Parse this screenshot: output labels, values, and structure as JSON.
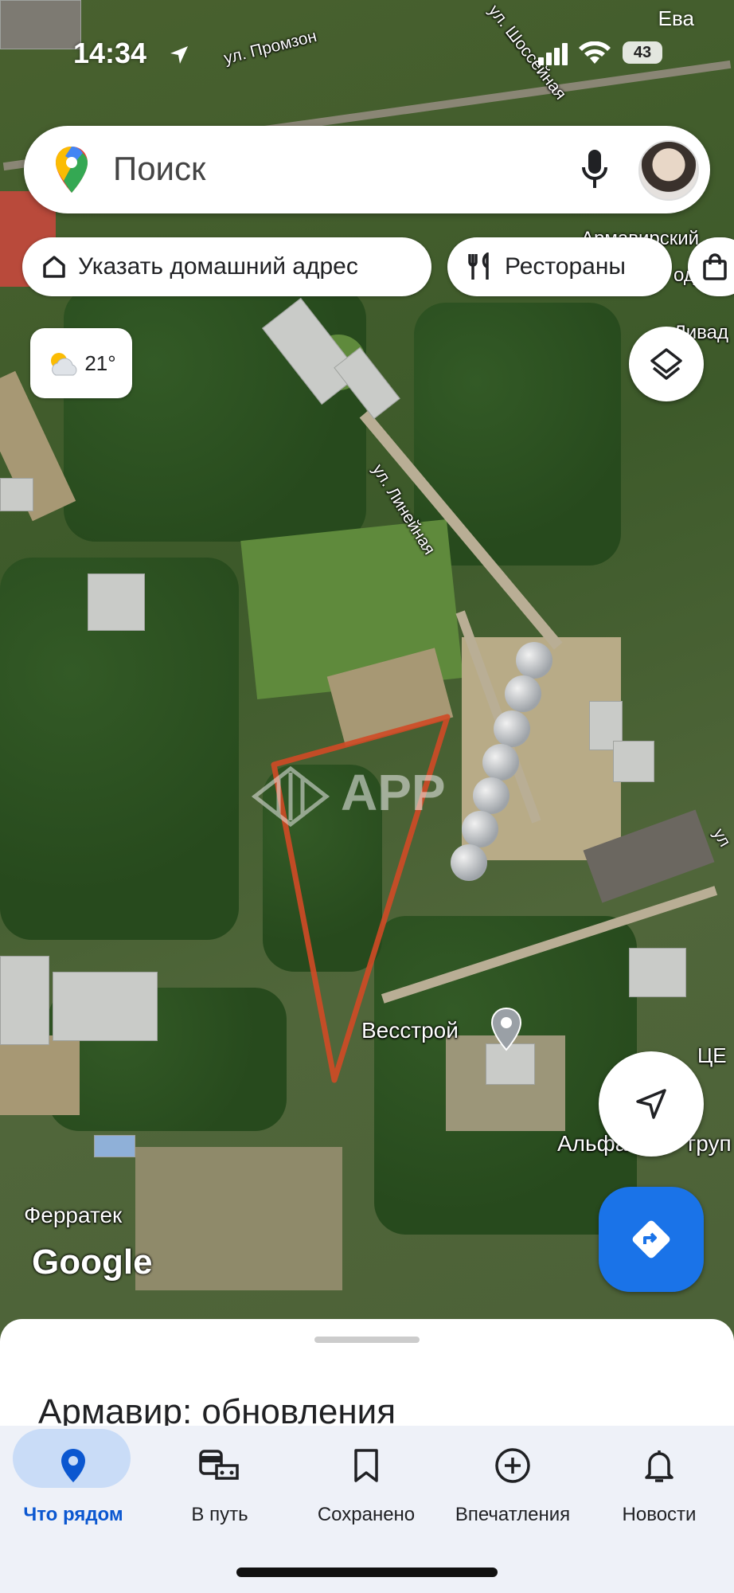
{
  "status_bar": {
    "time": "14:34",
    "battery": "43",
    "carrier_corner": "Ева"
  },
  "search": {
    "placeholder": "Поиск"
  },
  "chips": {
    "home": "Указать домашний адрес",
    "restaurants": "Рестораны"
  },
  "weather": {
    "temperature": "21°"
  },
  "map_labels": {
    "street_promzon": "ул. Промзон",
    "street_shosseynaya": "ул. Шоссейная",
    "street_lineynaya": "ул. Линейная",
    "armavirsky": "Армавирский",
    "armavirsky_2": "од",
    "livad": "Ливад",
    "ul_right": "ул",
    "vesstroy": "Весстрой",
    "tsen": "ЦЕ",
    "alfa": "Альфа",
    "group": "груп",
    "ferratek": "Ферратек",
    "watermark": "APP"
  },
  "logo": "Google",
  "sheet": {
    "title": "Армавир: обновления"
  },
  "nav": [
    {
      "label": "Что рядом",
      "icon": "location-pin-icon",
      "active": true
    },
    {
      "label": "В путь",
      "icon": "commute-icon",
      "active": false
    },
    {
      "label": "Сохранено",
      "icon": "bookmark-icon",
      "active": false
    },
    {
      "label": "Впечатления",
      "icon": "add-circle-icon",
      "active": false
    },
    {
      "label": "Новости",
      "icon": "bell-icon",
      "active": false
    }
  ],
  "colors": {
    "accent_blue": "#1a73e8",
    "nav_active": "#0b57d0",
    "outline_red": "#d04a26"
  }
}
